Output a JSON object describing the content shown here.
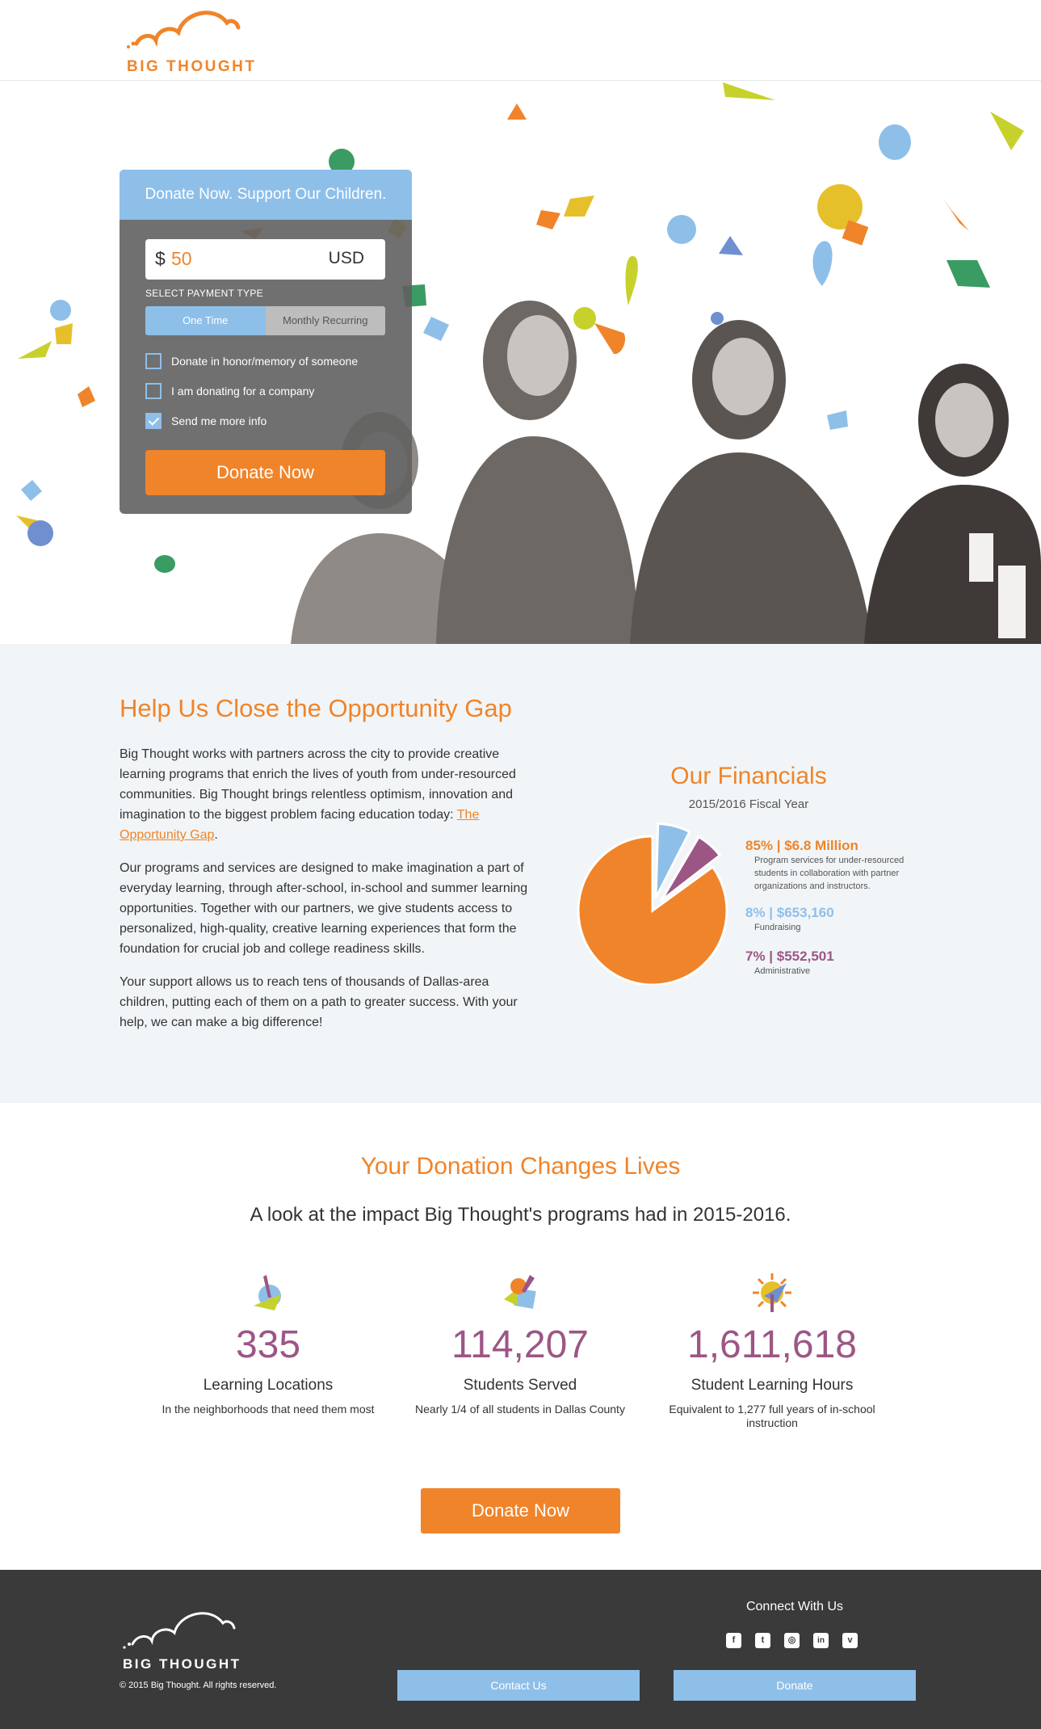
{
  "brand": {
    "name": "BIG THOUGHT",
    "accent": "#f0842a",
    "blue": "#8ebfe9",
    "purple": "#9c5686"
  },
  "donate_form": {
    "heading": "Donate Now. Support Our Children.",
    "currency_symbol": "$",
    "amount": "50",
    "currency": "USD",
    "payment_label": "SELECT PAYMENT TYPE",
    "payment_options": [
      "One Time",
      "Monthly Recurring"
    ],
    "selected_payment": "One Time",
    "checkboxes": [
      {
        "label": "Donate in honor/memory of someone",
        "checked": false
      },
      {
        "label": "I am donating for a company",
        "checked": false
      },
      {
        "label": "Send me more info",
        "checked": true
      }
    ],
    "submit_label": "Donate Now"
  },
  "opportunity": {
    "title": "Help Us Close the Opportunity Gap",
    "para1": "Big Thought works with partners across the city to provide creative learning programs that enrich the lives of youth from under-resourced communities. Big Thought brings relentless optimism, innovation and imagination to the biggest problem facing education today: ",
    "para1_link": "The Opportunity Gap",
    "para1_end": ".",
    "para2": "Our programs and services are designed to make imagination a part of everyday learning, through after-school, in-school and summer learning opportunities. Together with our partners, we give students access to personalized, high-quality, creative learning experiences that form the foundation for crucial job and college readiness skills.",
    "para3": "Your support allows us to reach tens of thousands of Dallas-area children, putting each of them on a path to greater success. With your help, we can make a big difference!"
  },
  "financials": {
    "title": "Our Financials",
    "subtitle": "2015/2016 Fiscal Year",
    "items": [
      {
        "headline": "85% | $6.8 Million",
        "desc": "Program services for under-resourced students in collaboration with partner organizations and instructors.",
        "color": "#f0842a"
      },
      {
        "headline": "8% | $653,160",
        "desc": "Fundraising",
        "color": "#8ebfe9"
      },
      {
        "headline": "7% | $552,501",
        "desc": "Administrative",
        "color": "#9c5686"
      }
    ]
  },
  "chart_data": {
    "type": "pie",
    "title": "Our Financials",
    "subtitle": "2015/2016 Fiscal Year",
    "categories": [
      "Program services",
      "Fundraising",
      "Administrative"
    ],
    "values": [
      85,
      8,
      7
    ],
    "colors": [
      "#f0842a",
      "#8ebfe9",
      "#9c5686"
    ]
  },
  "impact": {
    "title": "Your Donation Changes Lives",
    "subtitle": "A look at the impact Big Thought's programs had in 2015-2016.",
    "stats": [
      {
        "number": "335",
        "label": "Learning Locations",
        "desc": "In the neighborhoods that need them most",
        "icon": "paint-splash-icon"
      },
      {
        "number": "114,207",
        "label": "Students Served",
        "desc": "Nearly 1/4 of all students in Dallas County",
        "icon": "shapes-icon"
      },
      {
        "number": "1,611,618",
        "label": "Student Learning Hours",
        "desc": "Equivalent to 1,277 full years of in-school instruction",
        "icon": "sun-icon"
      }
    ],
    "cta": "Donate Now"
  },
  "footer": {
    "brand": "BIG THOUGHT",
    "copyright": "© 2015 Big Thought. All rights reserved.",
    "connect": "Connect With Us",
    "socials": [
      "facebook-icon",
      "twitter-icon",
      "instagram-icon",
      "linkedin-icon",
      "vimeo-icon"
    ],
    "social_glyphs": [
      "f",
      "t",
      "◎",
      "in",
      "v"
    ],
    "contact_label": "Contact Us",
    "donate_label": "Donate"
  }
}
